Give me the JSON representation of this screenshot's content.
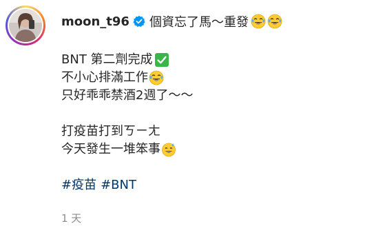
{
  "post": {
    "username": "moon_t96",
    "header_text": "個資忘了馬～重發",
    "lines": [
      "BNT 第二劑完成",
      "不小心排滿工作",
      "只好乖乖禁酒2週了～～"
    ],
    "lines2": [
      "打疫苗打到ㄎㄧㄤ",
      "今天發生一堆笨事"
    ],
    "hashtags": [
      "#疫苗",
      "#BNT"
    ],
    "time": "1 天",
    "icons": {
      "verified": "verified-badge-icon",
      "joy": "face-with-tears-of-joy-emoji",
      "check": "check-mark-button-emoji",
      "sweat": "grinning-face-with-sweat-emoji"
    },
    "colors": {
      "hashtag": "#00376b",
      "verified": "#0095f6",
      "time": "#8e8e8e"
    }
  }
}
